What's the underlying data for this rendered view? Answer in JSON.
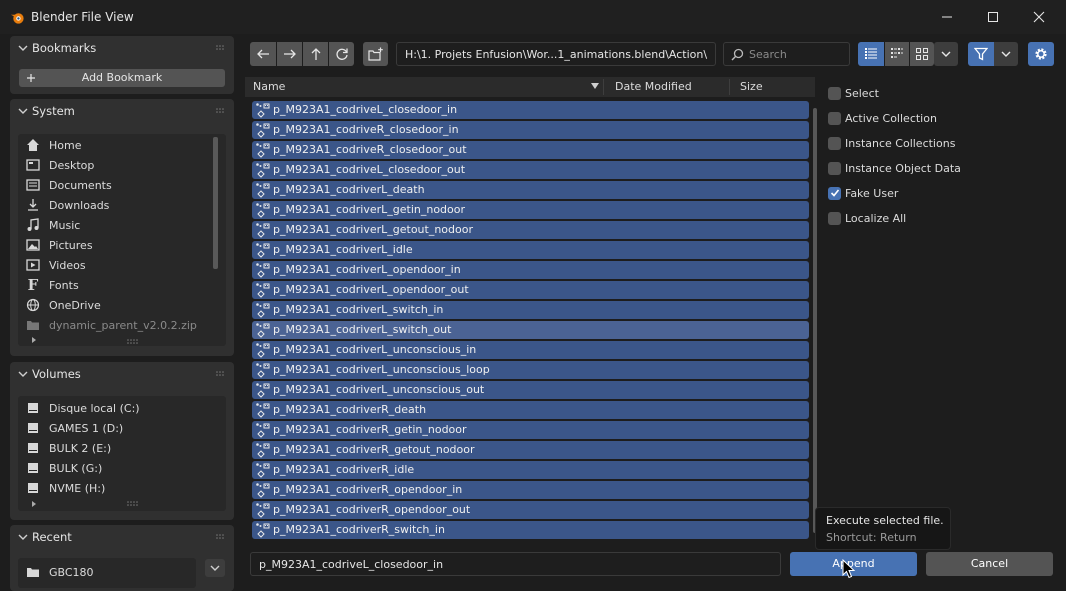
{
  "window": {
    "title": "Blender File View"
  },
  "bookmarks": {
    "title": "Bookmarks",
    "add_label": "Add Bookmark"
  },
  "system": {
    "title": "System",
    "items": [
      {
        "label": "Home",
        "icon": "home-icon"
      },
      {
        "label": "Desktop",
        "icon": "desktop-icon"
      },
      {
        "label": "Documents",
        "icon": "documents-icon"
      },
      {
        "label": "Downloads",
        "icon": "downloads-icon"
      },
      {
        "label": "Music",
        "icon": "music-icon"
      },
      {
        "label": "Pictures",
        "icon": "pictures-icon"
      },
      {
        "label": "Videos",
        "icon": "videos-icon"
      },
      {
        "label": "Fonts",
        "icon": "fonts-icon"
      },
      {
        "label": "OneDrive",
        "icon": "globe-icon"
      },
      {
        "label": "dynamic_parent_v2.0.2.zip",
        "icon": "folder-icon"
      }
    ]
  },
  "volumes": {
    "title": "Volumes",
    "items": [
      {
        "label": "Disque local (C:)",
        "icon": "disk-icon"
      },
      {
        "label": "GAMES 1 (D:)",
        "icon": "disk-icon"
      },
      {
        "label": "BULK 2 (E:)",
        "icon": "disk-icon"
      },
      {
        "label": "BULK (G:)",
        "icon": "disk-icon"
      },
      {
        "label": "NVME (H:)",
        "icon": "disk-icon"
      }
    ]
  },
  "recent": {
    "title": "Recent",
    "items": [
      {
        "label": "GBC180",
        "icon": "folder-icon"
      }
    ]
  },
  "toolbar": {
    "path": "H:\\1. Projets Enfusion\\Wor...1_animations.blend\\Action\\",
    "search_placeholder": "Search"
  },
  "columns": {
    "name": "Name",
    "date": "Date Modified",
    "size": "Size"
  },
  "files": [
    "p_M923A1_codriveL_closedoor_in",
    "p_M923A1_codriveR_closedoor_in",
    "p_M923A1_codriveR_closedoor_out",
    "p_M923A1_codriveL_closedoor_out",
    "p_M923A1_codriverL_death",
    "p_M923A1_codriverL_getin_nodoor",
    "p_M923A1_codriverL_getout_nodoor",
    "p_M923A1_codriverL_idle",
    "p_M923A1_codriverL_opendoor_in",
    "p_M923A1_codriverL_opendoor_out",
    "p_M923A1_codriverL_switch_in",
    "p_M923A1_codriverL_switch_out",
    "p_M923A1_codriverL_unconscious_in",
    "p_M923A1_codriverL_unconscious_loop",
    "p_M923A1_codriverL_unconscious_out",
    "p_M923A1_codriverR_death",
    "p_M923A1_codriverR_getin_nodoor",
    "p_M923A1_codriverR_getout_nodoor",
    "p_M923A1_codriverR_idle",
    "p_M923A1_codriverR_opendoor_in",
    "p_M923A1_codriverR_opendoor_out",
    "p_M923A1_codriverR_switch_in"
  ],
  "options": [
    {
      "label": "Select",
      "checked": false
    },
    {
      "label": "Active Collection",
      "checked": false
    },
    {
      "label": "Instance Collections",
      "checked": false
    },
    {
      "label": "Instance Object Data",
      "checked": false
    },
    {
      "label": "Fake User",
      "checked": true
    },
    {
      "label": "Localize All",
      "checked": false
    }
  ],
  "bottom": {
    "filename": "p_M923A1_codriveL_closedoor_in",
    "append_label": "Append",
    "cancel_label": "Cancel"
  },
  "tooltip": {
    "line1": "Execute selected file.",
    "line2": "Shortcut: Return"
  },
  "colors": {
    "accent": "#4772b3",
    "selected_row": "#3b5689"
  }
}
